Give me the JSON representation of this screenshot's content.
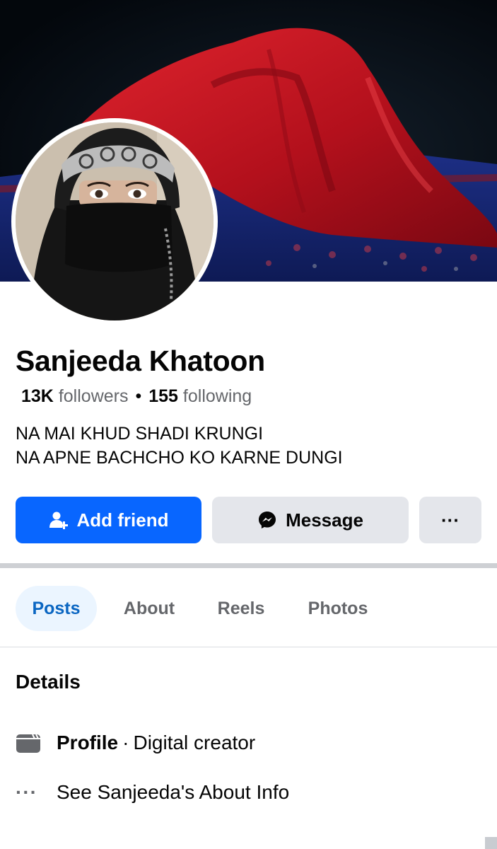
{
  "profile": {
    "name": "Sanjeeda Khatoon",
    "followers_count": "13K",
    "followers_label": "followers",
    "separator": "•",
    "following_count": "155",
    "following_label": "following",
    "bio_line1": "NA MAI KHUD SHADI KRUNGI",
    "bio_line2": "NA APNE BACHCHO KO KARNE DUNGI"
  },
  "actions": {
    "add_friend_label": "Add friend",
    "add_friend_icon": "add-person-icon",
    "message_label": "Message",
    "message_icon": "messenger-icon",
    "more_label": "···"
  },
  "tabs": [
    {
      "label": "Posts",
      "active": true
    },
    {
      "label": "About",
      "active": false
    },
    {
      "label": "Reels",
      "active": false
    },
    {
      "label": "Photos",
      "active": false
    }
  ],
  "details": {
    "title": "Details",
    "profile_label": "Profile",
    "profile_separator": "·",
    "profile_value": "Digital creator",
    "about_link": "See Sanjeeda's About Info",
    "about_icon_text": "···"
  },
  "colors": {
    "accent": "#0866ff",
    "tab_active_bg": "#ebf5ff",
    "tab_active_text": "#0a66c2",
    "button_gray": "#e4e6eb",
    "secondary_text": "#65676b"
  }
}
